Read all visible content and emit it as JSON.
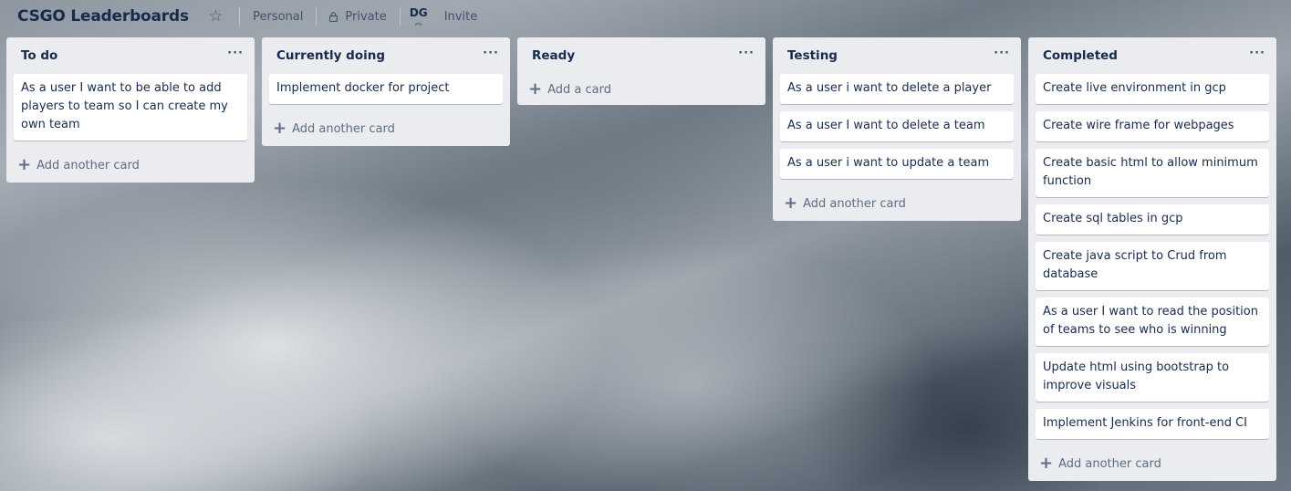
{
  "header": {
    "board_title": "CSGO Leaderboards",
    "star_icon": "star-icon",
    "personal_label": "Personal",
    "visibility_label": "Private",
    "avatar_initials": "DG",
    "invite_label": "Invite"
  },
  "lists": [
    {
      "title": "To do",
      "cards": [
        "As a user I want to be able to add players to team so I can create my own team"
      ],
      "add_label": "Add another card"
    },
    {
      "title": "Currently doing",
      "cards": [
        "Implement docker for project"
      ],
      "add_label": "Add another card"
    },
    {
      "title": "Ready",
      "cards": [],
      "add_label": "Add a card"
    },
    {
      "title": "Testing",
      "cards": [
        "As a user i want to delete a player",
        "As a user I want to delete a team",
        "As a user i want to update a team"
      ],
      "add_label": "Add another card"
    },
    {
      "title": "Completed",
      "cards": [
        "Create live environment in gcp",
        "Create wire frame for webpages",
        "Create basic html to allow minimum function",
        "Create sql tables in gcp",
        "Create java script to Crud from database",
        "As a user I want to read the position of teams to see who is winning",
        "Update html using bootstrap to improve visuals",
        "Implement Jenkins for front-end CI"
      ],
      "add_label": "Add another card"
    }
  ],
  "list_menu_glyph": "···",
  "plus_glyph": "+"
}
